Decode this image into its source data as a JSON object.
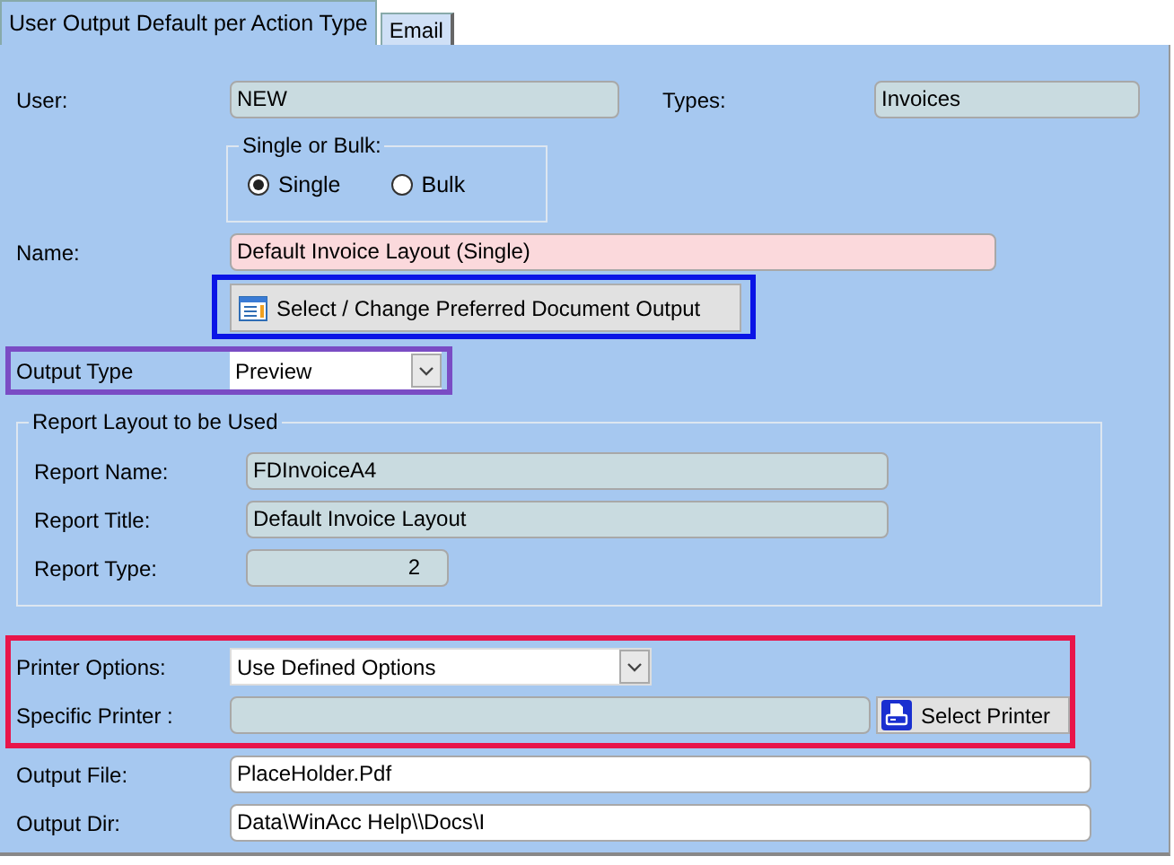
{
  "tabs": [
    {
      "label": "User Output Default per Action Type",
      "selected": true
    },
    {
      "label": "Email",
      "selected": false
    }
  ],
  "user": {
    "label": "User:",
    "value": "NEW"
  },
  "types": {
    "label": "Types:",
    "value": "Invoices"
  },
  "single_or_bulk": {
    "title": "Single or Bulk:",
    "options": [
      {
        "label": "Single",
        "selected": true
      },
      {
        "label": "Bulk",
        "selected": false
      }
    ]
  },
  "name": {
    "label": "Name:",
    "value": "Default Invoice Layout (Single)"
  },
  "select_output_button": {
    "label": "Select / Change Preferred Document Output",
    "highlight": {
      "color": "#0a14e6"
    }
  },
  "output_type": {
    "label": "Output Type",
    "value": "Preview",
    "highlight": {
      "color": "#7a4cc4"
    }
  },
  "report_layout": {
    "title": "Report Layout to be Used",
    "rows": [
      {
        "label": "Report Name:",
        "value": "FDInvoiceA4",
        "kind": "wide"
      },
      {
        "label": "Report Title:",
        "value": "Default Invoice Layout",
        "kind": "wide"
      },
      {
        "label": "Report Type:",
        "value": "2",
        "kind": "number"
      }
    ]
  },
  "printer": {
    "highlight": {
      "color": "#e8154a"
    },
    "options_label": "Printer Options:",
    "options_value": "Use Defined Options",
    "specific_label": "Specific Printer :",
    "button": "Select Printer"
  },
  "output_file": {
    "label": "Output File:",
    "value": "PlaceHolder.Pdf"
  },
  "output_dir": {
    "label": "Output Dir:",
    "value": "Data\\WinAcc Help\\\\Docs\\I"
  }
}
